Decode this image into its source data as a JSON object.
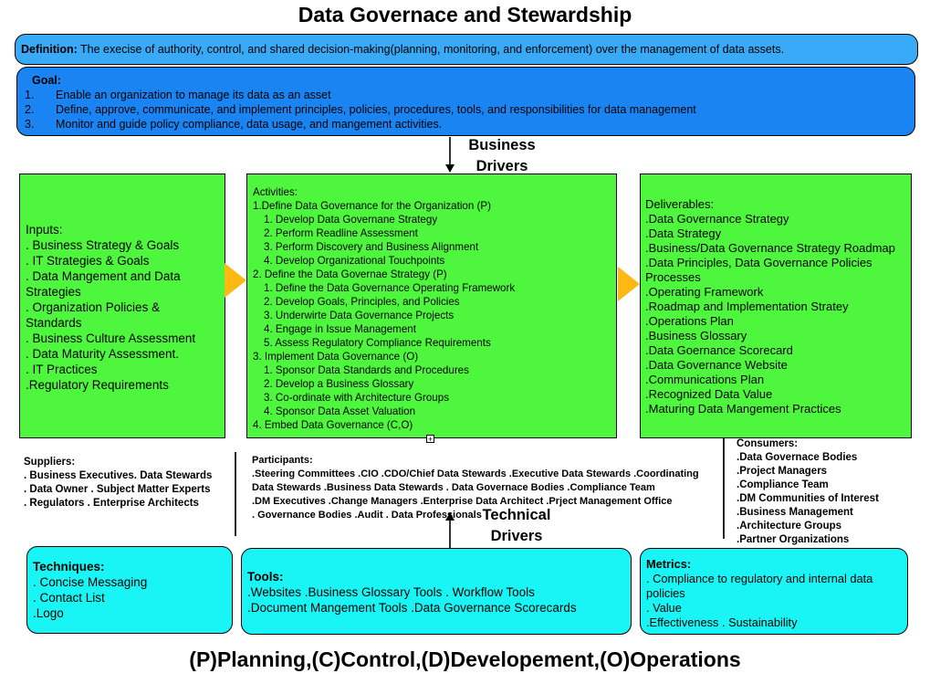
{
  "title": "Data Governace and Stewardship",
  "definition": {
    "label": "Definition:",
    "text": "The execise of authority, control, and shared decision-making(planning, monitoring, and enforcement) over the management of data assets."
  },
  "goal": {
    "label": "Goal:",
    "items": [
      {
        "num": "1.",
        "text": "Enable an organization to manage its data as an asset"
      },
      {
        "num": "2.",
        "text": "Define, approve, communicate, and implement principles, policies, procedures, tools, and responsibilities for data management"
      },
      {
        "num": "3.",
        "text": "Monitor and guide policy compliance, data usage, and mangement activities."
      }
    ]
  },
  "business_drivers": [
    "Business",
    "Drivers"
  ],
  "technical_drivers": [
    "Technical",
    "Drivers"
  ],
  "inputs": {
    "label": "Inputs:",
    "items": [
      ". Business Strategy & Goals",
      ". IT Strategies & Goals",
      ". Data Mangement and Data Strategies",
      ". Organization Policies & Standards",
      ". Business Culture Assessment",
      ". Data Maturity Assessment.",
      ". IT Practices",
      ".Regulatory Requirements"
    ]
  },
  "activities": {
    "label": "Activities:",
    "lines": [
      {
        "t": "1.Define Data Governance for the Organization (P)",
        "i": 0
      },
      {
        "t": "1. Develop Data Governane Strategy",
        "i": 1
      },
      {
        "t": "2. Perform Readline Assessment",
        "i": 1
      },
      {
        "t": "3. Perform Discovery and Business Alignment",
        "i": 1
      },
      {
        "t": "4. Develop Organizational Touchpoints",
        "i": 1
      },
      {
        "t": "2. Define the Data Governae Strategy (P)",
        "i": 0
      },
      {
        "t": "1. Define the Data Governance Operating Framework",
        "i": 1
      },
      {
        "t": "2. Develop Goals, Principles, and Policies",
        "i": 1
      },
      {
        "t": "3. Underwirte Data Governance Projects",
        "i": 1
      },
      {
        "t": "4. Engage in Issue Management",
        "i": 1
      },
      {
        "t": "5. Assess Regulatory Compliance Requirements",
        "i": 1
      },
      {
        "t": "3. Implement Data Governance (O)",
        "i": 0
      },
      {
        "t": "1. Sponsor Data Standards and Procedures",
        "i": 1
      },
      {
        "t": "2. Develop a Business Glossary",
        "i": 1
      },
      {
        "t": "3. Co-ordinate with Architecture Groups",
        "i": 1
      },
      {
        "t": "4. Sponsor Data Asset Valuation",
        "i": 1
      },
      {
        "t": "4. Embed Data Governance (C,O)",
        "i": 0
      }
    ]
  },
  "deliverables": {
    "label": "Deliverables:",
    "items": [
      ".Data Governance Strategy",
      ".Data Strategy",
      ".Business/Data Governance Strategy Roadmap",
      ".Data Principles, Data Governance Policies Processes",
      ".Operating Framework",
      ".Roadmap and Implementation Stratey",
      ".Operations Plan",
      ".Business Glossary",
      ".Data Goernance Scorecard",
      ".Data Governance Website",
      ".Communications Plan",
      ".Recognized Data Value",
      ".Maturing Data Mangement Practices"
    ]
  },
  "suppliers": {
    "label": "Suppliers:",
    "lines": [
      ". Business Executives. Data Stewards",
      ". Data Owner . Subject Matter Experts",
      ". Regulators . Enterprise Architects"
    ]
  },
  "participants": {
    "label": "Participants:",
    "lines": [
      ".Steering Committees .CIO .CDO/Chief Data Stewards .Executive Data Stewards .Coordinating",
      "Data Stewards .Business Data Stewards . Data Governace Bodies .Compliance Team",
      ".DM Executives .Change Managers .Enterprise Data Architect .Prject Management Office",
      ". Governance Bodies .Audit . Data Professionals"
    ]
  },
  "consumers": {
    "label": "Consumers:",
    "items": [
      ".Data Governace Bodies",
      ".Project Managers",
      ".Compliance Team",
      ".DM Communities of Interest",
      ".Business Management",
      ".Architecture Groups",
      ".Partner Organizations"
    ]
  },
  "techniques": {
    "label": "Techniques:",
    "items": [
      ". Concise Messaging",
      ". Contact List",
      ".Logo"
    ]
  },
  "tools": {
    "label": "Tools:",
    "lines": [
      ".Websites .Business Glossary Tools . Workflow Tools",
      ".Document Mangement Tools .Data Governance Scorecards"
    ]
  },
  "metrics": {
    "label": "Metrics:",
    "lines": [
      ". Compliance to regulatory and internal data policies",
      ". Value",
      ".Effectiveness . Sustainability"
    ]
  },
  "footer": "(P)Planning,(C)Control,(D)Developement,(O)Operations",
  "colors": {
    "definition": "#39aaf7",
    "goal": "#1a85f2",
    "green": "#4ef73e",
    "cyan": "#19f5f5",
    "arrow": "#fdb813"
  }
}
